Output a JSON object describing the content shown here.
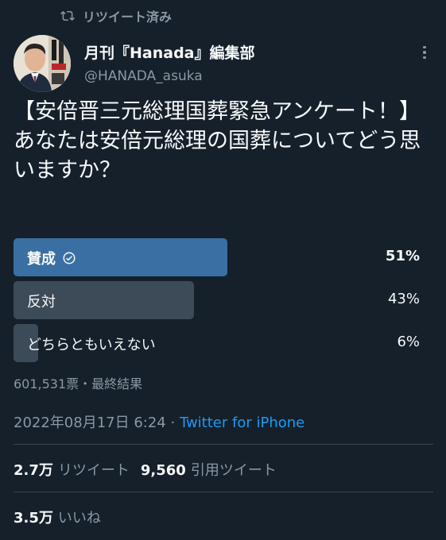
{
  "retweet_indicator": {
    "label": "リツイート済み",
    "icon": "retweet-icon"
  },
  "author": {
    "name": "月刊『Hanada』編集部",
    "handle": "@HANADA_asuka"
  },
  "tweet": {
    "text": "【安倍晋三元総理国葬緊急アンケート！】\nあなたは安倍元総理の国葬についてどう思いますか？"
  },
  "poll": {
    "options": [
      {
        "label": "賛成",
        "percent_text": "51%",
        "percent": 51,
        "winner": true
      },
      {
        "label": "反対",
        "percent_text": "43%",
        "percent": 43,
        "winner": false
      },
      {
        "label": "どちらともいえない",
        "percent_text": "6%",
        "percent": 6,
        "winner": false
      }
    ],
    "meta": "601,531票・最終結果"
  },
  "timestamp": {
    "date": "2022年08月17日 6:24",
    "separator": " · ",
    "source": "Twitter for iPhone"
  },
  "stats": {
    "retweets_count": "2.7万",
    "retweets_label": "リツイート",
    "quotes_count": "9,560",
    "quotes_label": "引用ツイート",
    "likes_count": "3.5万",
    "likes_label": "いいね"
  },
  "colors": {
    "background": "#15202b",
    "winner_bar": "#3a6fa3",
    "bar": "#3d4a58",
    "link": "#1d9bf0",
    "secondary_text": "#8b98a5"
  }
}
